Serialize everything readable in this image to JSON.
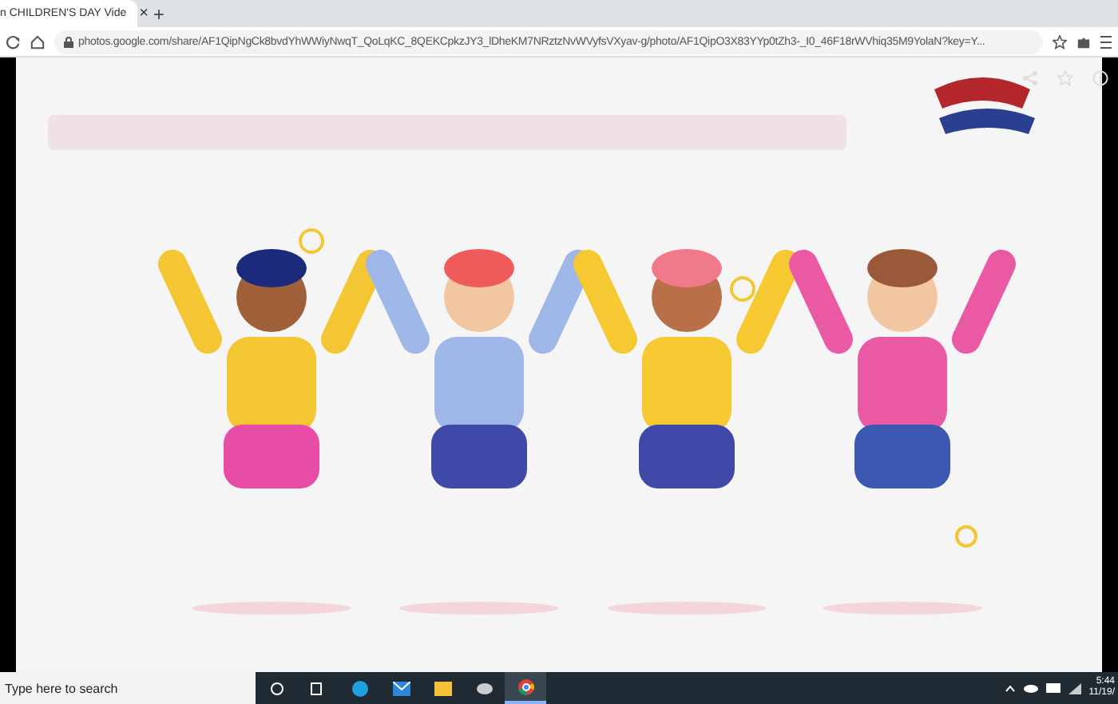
{
  "tab": {
    "title": "n CHILDREN'S DAY Vide",
    "close": "×"
  },
  "new_tab": "+",
  "address_bar": {
    "url": "photos.google.com/share/AF1QipNgCk8bvdYhWWiyNwqT_QoLqKC_8QEKCpkzJY3_lDheKM7NRztzNvWVyfsVXyav-g/photo/AF1QipO3X83YYp0tZh3-_I0_46F18rWVhiq35M9YolaN?key=Y..."
  },
  "taskbar": {
    "search_placeholder": "Type here to search",
    "time": "5:44",
    "date": "11/19/"
  }
}
